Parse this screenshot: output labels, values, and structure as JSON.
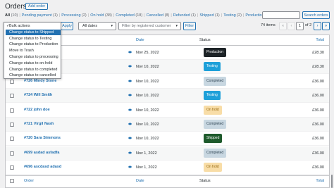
{
  "header": {
    "title": "Orders",
    "add_order_label": "Add order"
  },
  "status_links": [
    {
      "label": "All",
      "count": "(10)",
      "current": true
    },
    {
      "label": "Pending payment",
      "count": "(1)",
      "current": false
    },
    {
      "label": "Processing",
      "count": "(2)",
      "current": false
    },
    {
      "label": "On hold",
      "count": "(38)",
      "current": false
    },
    {
      "label": "Completed",
      "count": "(18)",
      "current": false
    },
    {
      "label": "Cancelled",
      "count": "(8)",
      "current": false
    },
    {
      "label": "Refunded",
      "count": "(1)",
      "current": false
    },
    {
      "label": "Shipped",
      "count": "(1)",
      "current": false
    },
    {
      "label": "Testing",
      "count": "(2)",
      "current": false
    },
    {
      "label": "Production",
      "count": "(2)",
      "current": false
    }
  ],
  "search": {
    "value": "",
    "button_label": "Search orders"
  },
  "bulk_actions": {
    "selected_index": 1,
    "options": [
      "Bulk actions",
      "Change status to Shipped",
      "Change status to Testing",
      "Change status to Production",
      "Move to Trash",
      "Change status to processing",
      "Change status to on-hold",
      "Change status to completed",
      "Change status to cancelled"
    ],
    "apply_label": "Apply"
  },
  "filters": {
    "dates_value": "All dates",
    "customer_placeholder": "Filter by registered customer",
    "filter_label": "Filter"
  },
  "pagination": {
    "items_count": "74 items",
    "first": "«",
    "prev": "‹",
    "current_page": "1",
    "of_text": "of 2",
    "next": "›",
    "last": "»"
  },
  "table": {
    "columns": {
      "order": "Order",
      "date": "Date",
      "status": "Status",
      "total": "Total"
    },
    "rows": [
      {
        "order": "",
        "date": "Nov 25, 2022",
        "status": "Production",
        "status_bg": "#1d2327",
        "status_fg": "#ffffff",
        "total": "£28.30"
      },
      {
        "order": "",
        "date": "Nov 10, 2022",
        "status": "Testing",
        "status_bg": "#1ea0d9",
        "status_fg": "#ffffff",
        "total": "£28.30"
      },
      {
        "order": "#726 Mindy Stone",
        "date": "Nov 10, 2022",
        "status": "Completed",
        "status_bg": "#c8d7e1",
        "status_fg": "#2e4453",
        "total": "£36.00"
      },
      {
        "order": "#724 Will Smith",
        "date": "Nov 10, 2022",
        "status": "Testing",
        "status_bg": "#1ea0d9",
        "status_fg": "#ffffff",
        "total": "£36.00"
      },
      {
        "order": "#722 john doe",
        "date": "Nov 10, 2022",
        "status": "On hold",
        "status_bg": "#f8dda7",
        "status_fg": "#94660c",
        "total": "£36.00"
      },
      {
        "order": "#721 Virgil Nash",
        "date": "Nov 10, 2022",
        "status": "Completed",
        "status_bg": "#c8d7e1",
        "status_fg": "#2e4453",
        "total": "£36.00"
      },
      {
        "order": "#720 Sara Simmons",
        "date": "Nov 10, 2022",
        "status": "Shipped",
        "status_bg": "#1e5a2c",
        "status_fg": "#ffffff",
        "total": "£36.00"
      },
      {
        "order": "#699 asdad asfadfa",
        "date": "Nov 1, 2022",
        "status": "Completed",
        "status_bg": "#c8d7e1",
        "status_fg": "#2e4453",
        "total": "£36.00"
      },
      {
        "order": "#696 ascdasd adasd",
        "date": "Nov 1, 2022",
        "status": "On hold",
        "status_bg": "#f8dda7",
        "status_fg": "#94660c",
        "total": "£36.00"
      }
    ]
  },
  "colors": {
    "accent": "#2271b1",
    "bulk_highlight": "#2271b1"
  },
  "icons": {
    "preview": "eye-icon",
    "check": "checkmark-icon",
    "caret": "chevron-down-icon"
  }
}
